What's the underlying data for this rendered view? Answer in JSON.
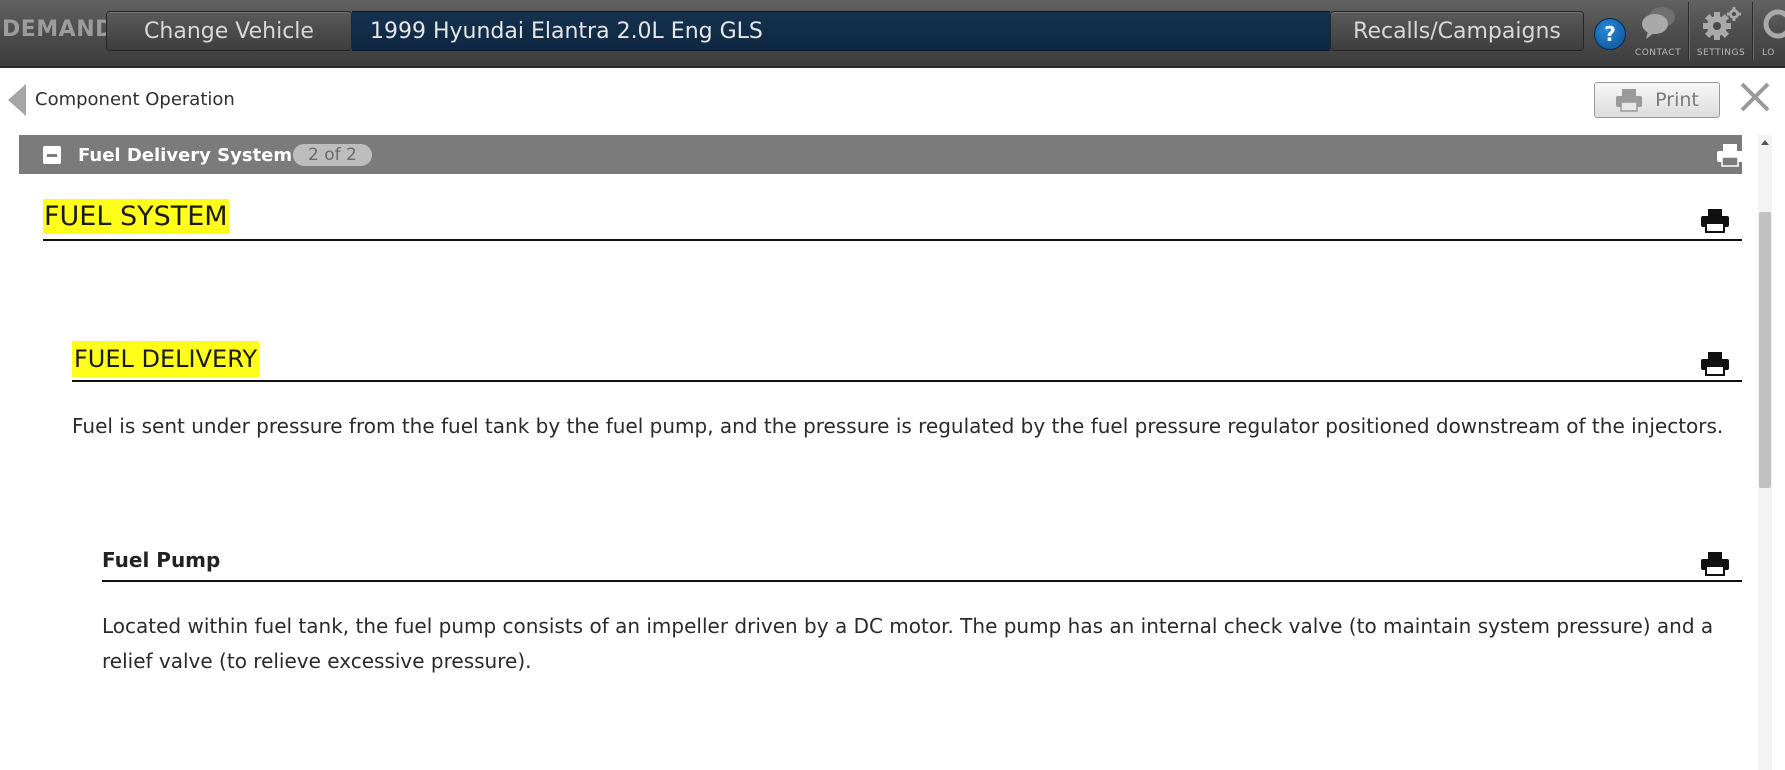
{
  "topbar": {
    "brand": "DEMAND",
    "change_vehicle": "Change Vehicle",
    "vehicle": "1999 Hyundai Elantra 2.0L Eng GLS",
    "recalls": "Recalls/Campaigns",
    "help": "?",
    "contact": "CONTACT",
    "settings": "SETTINGS",
    "logout": "LO"
  },
  "header": {
    "breadcrumb": "Component Operation",
    "print": "Print"
  },
  "section": {
    "title": "Fuel Delivery System",
    "counter": "2 of 2"
  },
  "content": {
    "h1": "FUEL SYSTEM",
    "h2": "FUEL DELIVERY",
    "p1": "Fuel is sent under pressure from the fuel tank by the fuel pump, and the pressure is regulated by the fuel pressure regulator positioned downstream of the injectors.",
    "h3": "Fuel Pump",
    "p2": "Located within fuel tank, the fuel pump consists of an impeller driven by a DC motor. The pump has an internal check valve (to maintain system pressure) and a relief valve (to relieve excessive pressure)."
  },
  "colors": {
    "highlight": "#ffff1a",
    "vehicle_bar": "#0e2843",
    "section_bar": "#7b7b7b"
  }
}
